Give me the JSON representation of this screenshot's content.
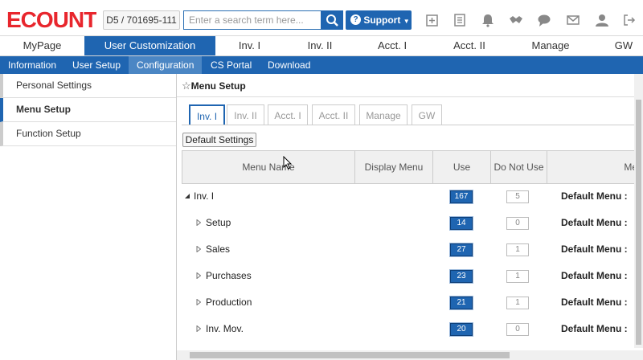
{
  "header": {
    "logo_text": "ECOUNT",
    "company_code": "D5 / 701695-111",
    "search_placeholder": "Enter a search term here...",
    "support_label": "Support",
    "brand_color": "#1f65b1",
    "logo_color": "#e8262d"
  },
  "main_nav": [
    "MyPage",
    "User Customization",
    "Inv. I",
    "Inv. II",
    "Acct. I",
    "Acct. II",
    "Manage",
    "GW"
  ],
  "sub_nav": [
    "Information",
    "User Setup",
    "Configuration",
    "CS Portal",
    "Download"
  ],
  "left_menu": [
    "Personal Settings",
    "Menu Setup",
    "Function Setup"
  ],
  "content": {
    "title": "Menu Setup",
    "program_tabs": [
      "Inv. I",
      "Inv. II",
      "Acct. I",
      "Acct. II",
      "Manage",
      "GW"
    ],
    "default_button": "Default Settings",
    "columns": [
      "Menu Name",
      "Display Menu",
      "Use",
      "Do Not Use",
      "Me"
    ],
    "rows": [
      {
        "name": "Inv. I",
        "use": "167",
        "not_use": "5",
        "default": "Default Menu :"
      },
      {
        "name": "Setup",
        "use": "14",
        "not_use": "0",
        "default": "Default Menu :"
      },
      {
        "name": "Sales",
        "use": "27",
        "not_use": "1",
        "default": "Default Menu :"
      },
      {
        "name": "Purchases",
        "use": "23",
        "not_use": "1",
        "default": "Default Menu :"
      },
      {
        "name": "Production",
        "use": "21",
        "not_use": "1",
        "default": "Default Menu :"
      },
      {
        "name": "Inv. Mov.",
        "use": "20",
        "not_use": "0",
        "default": "Default Menu :"
      }
    ]
  }
}
